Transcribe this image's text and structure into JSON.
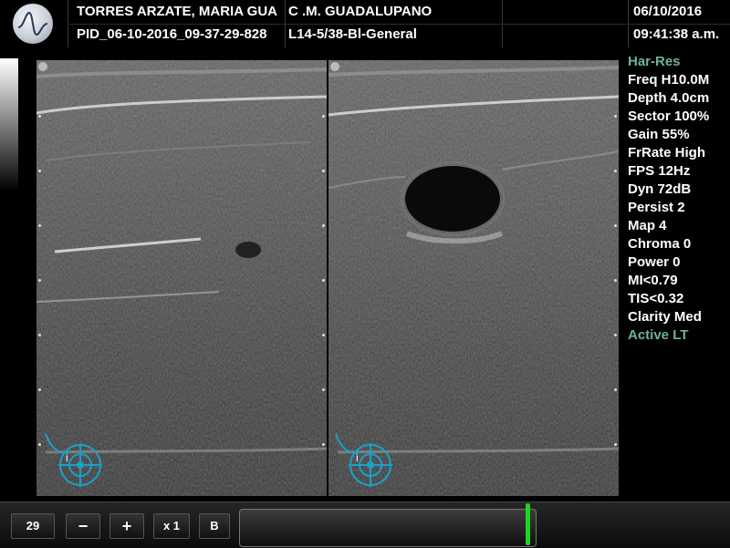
{
  "header": {
    "patient_name": "TORRES ARZATE, MARIA GUA",
    "institution": "C .M. GUADALUPANO",
    "patient_id": "PID_06-10-2016_09-37-29-828",
    "probe_preset": "L14-5/38-Bl-General",
    "date": "06/10/2016",
    "time": "09:41:38 a.m."
  },
  "parameters": [
    {
      "label": "Har-Res",
      "style": "teal"
    },
    {
      "label": "Freq H10.0M",
      "style": "white"
    },
    {
      "label": "Depth 4.0cm",
      "style": "white"
    },
    {
      "label": "Sector 100%",
      "style": "white"
    },
    {
      "label": "Gain 55%",
      "style": "white"
    },
    {
      "label": "FrRate High",
      "style": "white"
    },
    {
      "label": "FPS 12Hz",
      "style": "white"
    },
    {
      "label": "Dyn 72dB",
      "style": "white"
    },
    {
      "label": "Persist 2",
      "style": "white"
    },
    {
      "label": "Map 4",
      "style": "white"
    },
    {
      "label": "Chroma 0",
      "style": "white"
    },
    {
      "label": "Power 0",
      "style": "white"
    },
    {
      "label": "MI<0.79",
      "style": "white"
    },
    {
      "label": "TIS<0.32",
      "style": "white"
    },
    {
      "label": "Clarity Med",
      "style": "white"
    },
    {
      "label": "Active LT",
      "style": "teal"
    }
  ],
  "toolbar": {
    "frame_counter": "29",
    "minus_label": "−",
    "plus_label": "+",
    "zoom_label": "x 1",
    "mode_label": "B"
  },
  "colors": {
    "accent_teal": "#6fb1a0",
    "cine_marker": "#1fd41f",
    "orientation_icon": "#1aa0c8"
  },
  "icons": {
    "logo": "waveform-logo-icon",
    "orientation": "probe-orientation-icon"
  }
}
